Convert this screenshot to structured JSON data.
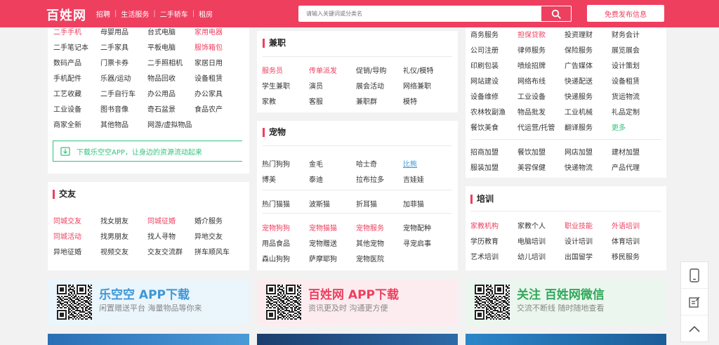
{
  "header": {
    "logo": "百姓网",
    "nav": [
      "招聘",
      "生活服务",
      "二手轿车",
      "租房"
    ],
    "search_placeholder": "请输入关键词或分类名",
    "post_label": "免费发布信息"
  },
  "left_panel": {
    "rows": [
      [
        {
          "t": "二手手机",
          "c": "red"
        },
        {
          "t": "母婴用品"
        },
        {
          "t": "台式电脑"
        },
        {
          "t": "家用电器",
          "c": "red"
        }
      ],
      [
        {
          "t": "二手笔记本"
        },
        {
          "t": "二手家具"
        },
        {
          "t": "平板电脑"
        },
        {
          "t": "服饰箱包",
          "c": "red"
        }
      ],
      [
        {
          "t": "数码产品"
        },
        {
          "t": "门票卡券"
        },
        {
          "t": "二手照相机"
        },
        {
          "t": "家居日用"
        }
      ],
      [
        {
          "t": "手机配件"
        },
        {
          "t": "乐器/运动"
        },
        {
          "t": "物品回收"
        },
        {
          "t": "设备租赁"
        }
      ],
      [
        {
          "t": "工艺收藏"
        },
        {
          "t": "二手自行车"
        },
        {
          "t": "办公用品"
        },
        {
          "t": "办公家具"
        }
      ],
      [
        {
          "t": "工业设备"
        },
        {
          "t": "图书音像"
        },
        {
          "t": "奇石盆景"
        },
        {
          "t": "食品农产"
        }
      ],
      [
        {
          "t": "商家全新"
        },
        {
          "t": "其他物品"
        },
        {
          "t": "网游/虚拟物品"
        }
      ]
    ],
    "app_link": "下载乐空空APP，让身边的资源流动起来"
  },
  "jiaoyou": {
    "title": "交友",
    "rows": [
      [
        {
          "t": "同城交友",
          "c": "red"
        },
        {
          "t": "找女朋友"
        },
        {
          "t": "同城征婚",
          "c": "red"
        },
        {
          "t": "婚介服务"
        }
      ],
      [
        {
          "t": "同城活动",
          "c": "red"
        },
        {
          "t": "找男朋友"
        },
        {
          "t": "找人寻物"
        },
        {
          "t": "异地交友"
        }
      ],
      [
        {
          "t": "异地征婚"
        },
        {
          "t": "视频交友"
        },
        {
          "t": "交友交流群"
        },
        {
          "t": "拼车顺风车"
        }
      ]
    ]
  },
  "jianzhi": {
    "title": "兼职",
    "rows": [
      [
        {
          "t": "服务员",
          "c": "red"
        },
        {
          "t": "传单派发",
          "c": "red"
        },
        {
          "t": "促销/导购"
        },
        {
          "t": "礼仪/模特"
        }
      ],
      [
        {
          "t": "学生兼职"
        },
        {
          "t": "演员"
        },
        {
          "t": "展会活动"
        },
        {
          "t": "网络兼职"
        }
      ],
      [
        {
          "t": "家教"
        },
        {
          "t": "客服"
        },
        {
          "t": "兼职群"
        },
        {
          "t": "模特"
        }
      ]
    ]
  },
  "chongwu": {
    "title": "宠物",
    "rows1": [
      [
        {
          "t": "热门狗狗"
        },
        {
          "t": "金毛"
        },
        {
          "t": "哈士奇"
        },
        {
          "t": "比熊",
          "c": "blue"
        }
      ],
      [
        {
          "t": "博美"
        },
        {
          "t": "泰迪"
        },
        {
          "t": "拉布拉多"
        },
        {
          "t": "吉娃娃"
        }
      ]
    ],
    "rows2": [
      [
        {
          "t": "热门猫猫"
        },
        {
          "t": "波斯猫"
        },
        {
          "t": "折耳猫"
        },
        {
          "t": "加菲猫"
        }
      ]
    ],
    "rows3": [
      [
        {
          "t": "宠物狗狗",
          "c": "red"
        },
        {
          "t": "宠物猫猫",
          "c": "red"
        },
        {
          "t": "宠物服务",
          "c": "red"
        },
        {
          "t": "宠物配种"
        }
      ],
      [
        {
          "t": "用品食品"
        },
        {
          "t": "宠物赠送"
        },
        {
          "t": "其他宠物"
        },
        {
          "t": "寻宠启事"
        }
      ],
      [
        {
          "t": "森山狗狗"
        },
        {
          "t": "萨摩耶狗"
        },
        {
          "t": "宠物医院"
        }
      ]
    ]
  },
  "right_panel": {
    "rows1": [
      [
        {
          "t": "商务服务"
        },
        {
          "t": "担保贷款",
          "c": "red"
        },
        {
          "t": "投资理财"
        },
        {
          "t": "财务会计"
        }
      ],
      [
        {
          "t": "公司注册"
        },
        {
          "t": "律师服务"
        },
        {
          "t": "保险服务"
        },
        {
          "t": "展览展会"
        }
      ],
      [
        {
          "t": "印刷包装"
        },
        {
          "t": "喷绘招牌"
        },
        {
          "t": "广告媒体"
        },
        {
          "t": "设计策划"
        }
      ],
      [
        {
          "t": "网站建设"
        },
        {
          "t": "网络布线"
        },
        {
          "t": "快递配送"
        },
        {
          "t": "设备租赁"
        }
      ],
      [
        {
          "t": "设备维修"
        },
        {
          "t": "工业设备"
        },
        {
          "t": "快递服务"
        },
        {
          "t": "货运物流"
        }
      ],
      [
        {
          "t": "农林牧副渔"
        },
        {
          "t": "物品批发"
        },
        {
          "t": "工业机械"
        },
        {
          "t": "礼品定制"
        }
      ],
      [
        {
          "t": "餐饮美食"
        },
        {
          "t": "代运营/托管"
        },
        {
          "t": "翻译服务"
        },
        {
          "t": "更多",
          "c": "green"
        }
      ]
    ],
    "rows2": [
      [
        {
          "t": "招商加盟"
        },
        {
          "t": "餐饮加盟"
        },
        {
          "t": "网店加盟"
        },
        {
          "t": "建材加盟"
        }
      ],
      [
        {
          "t": "服装加盟"
        },
        {
          "t": "美容保健"
        },
        {
          "t": "快递物流"
        },
        {
          "t": "产品代理"
        }
      ]
    ]
  },
  "peixun": {
    "title": "培训",
    "rows": [
      [
        {
          "t": "家教机构",
          "c": "red"
        },
        {
          "t": "家教个人"
        },
        {
          "t": "职业技能",
          "c": "red"
        },
        {
          "t": "外语培训",
          "c": "red"
        }
      ],
      [
        {
          "t": "学历教育"
        },
        {
          "t": "电脑培训"
        },
        {
          "t": "设计培训"
        },
        {
          "t": "体育培训"
        }
      ],
      [
        {
          "t": "艺术培训"
        },
        {
          "t": "幼儿培训"
        },
        {
          "t": "出国留学"
        },
        {
          "t": "移民服务"
        }
      ]
    ]
  },
  "promos": [
    {
      "title": "乐空空 APP下载",
      "sub": "闲置赠送平台 海量物品等你来",
      "color": "#3e97d6",
      "bg": "#eaf5fc"
    },
    {
      "title": "百姓网 APP下载",
      "sub": "资讯更及时 沟通更方便",
      "color": "#ee3f5f",
      "bg": "#fdecef"
    },
    {
      "title": "关注 百姓网微信",
      "sub": "交流不断线 随时随地查看",
      "color": "#31a85a",
      "bg": "#ebf6ee"
    }
  ],
  "icons": {
    "search": "search-icon",
    "download": "download-icon",
    "phone": "mobile-icon",
    "edit": "edit-icon",
    "top": "chevron-up-icon"
  }
}
